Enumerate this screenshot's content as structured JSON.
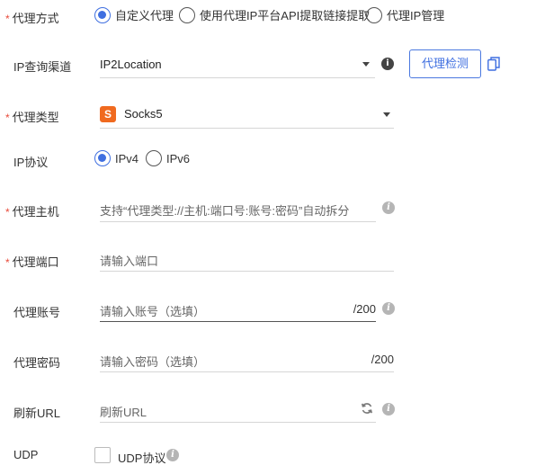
{
  "required_mark": "*",
  "proxy_mode": {
    "label": "代理方式",
    "options": [
      "自定义代理",
      "使用代理IP平台API提取链接提取",
      "代理IP管理"
    ],
    "selected": 0
  },
  "ip_query": {
    "label": "IP查询渠道",
    "value": "IP2Location",
    "check_button": "代理检测"
  },
  "proxy_type": {
    "label": "代理类型",
    "badge": "S",
    "value": "Socks5"
  },
  "ip_protocol": {
    "label": "IP协议",
    "options": [
      "IPv4",
      "IPv6"
    ],
    "selected": 0
  },
  "proxy_host": {
    "label": "代理主机",
    "placeholder": "支持“代理类型://主机:端口号:账号:密码”自动拆分"
  },
  "proxy_port": {
    "label": "代理端口",
    "placeholder": "请输入端口"
  },
  "proxy_account": {
    "label": "代理账号",
    "placeholder": "请输入账号（选填）",
    "counter": "/200"
  },
  "proxy_password": {
    "label": "代理密码",
    "placeholder": "请输入密码（选填）",
    "counter": "/200"
  },
  "refresh_url": {
    "label": "刷新URL",
    "placeholder": "刷新URL"
  },
  "udp": {
    "label": "UDP",
    "checkbox_label": "UDP协议",
    "checked": false
  },
  "icons": {
    "info": "i",
    "accent": "#3f6fe0",
    "badge_color": "#f06a1f",
    "required_color": "#e84a3a"
  }
}
